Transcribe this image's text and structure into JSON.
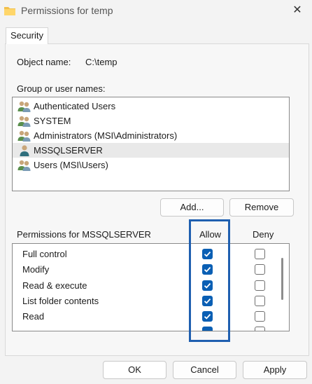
{
  "window": {
    "title": "Permissions for temp",
    "close_glyph": "✕"
  },
  "tabs": [
    {
      "label": "Security"
    }
  ],
  "object": {
    "label": "Object name:",
    "value": "C:\\temp"
  },
  "groups": {
    "label": "Group or user names:",
    "users": [
      {
        "name": "Authenticated Users",
        "icon": "user-group-icon",
        "selected": false
      },
      {
        "name": "SYSTEM",
        "icon": "user-group-icon",
        "selected": false
      },
      {
        "name": "Administrators (MSI\\Administrators)",
        "icon": "user-group-icon",
        "selected": false
      },
      {
        "name": "MSSQLSERVER",
        "icon": "user-icon",
        "selected": true
      },
      {
        "name": "Users (MSI\\Users)",
        "icon": "user-group-icon",
        "selected": false
      }
    ],
    "add_label": "Add...",
    "remove_label": "Remove"
  },
  "permissions": {
    "label": "Permissions for MSSQLSERVER",
    "allow_header": "Allow",
    "deny_header": "Deny",
    "rows": [
      {
        "name": "Full control",
        "allow": true,
        "deny": false
      },
      {
        "name": "Modify",
        "allow": true,
        "deny": false
      },
      {
        "name": "Read & execute",
        "allow": true,
        "deny": false
      },
      {
        "name": "List folder contents",
        "allow": true,
        "deny": false
      },
      {
        "name": "Read",
        "allow": true,
        "deny": false
      },
      {
        "name": "",
        "allow": true,
        "deny": false
      }
    ]
  },
  "footer": {
    "ok_label": "OK",
    "cancel_label": "Cancel",
    "apply_label": "Apply"
  },
  "colors": {
    "accent": "#0a5fb4",
    "highlight_border": "#1f5fb0",
    "selected_row": "#e9e9e9"
  }
}
